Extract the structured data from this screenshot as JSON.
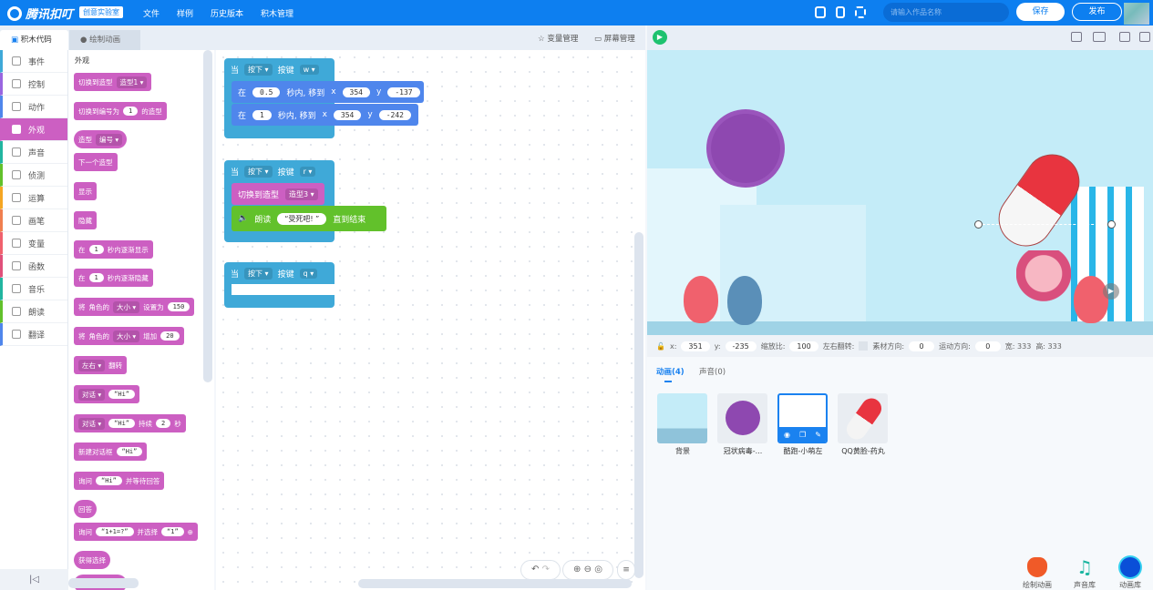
{
  "header": {
    "logo": "腾讯扣叮",
    "lab_badge": "创意实验室",
    "menu": [
      "文件",
      "样例",
      "历史版本",
      "积木管理"
    ],
    "name_placeholder": "请输入作品名称",
    "save": "保存",
    "publish": "发布"
  },
  "editor_tabs": [
    "积木代码",
    "绘制动画"
  ],
  "workspace_tools": {
    "variables": "变量管理",
    "screens": "屏幕管理"
  },
  "categories": [
    {
      "label": "事件",
      "color": "#3fa9d8"
    },
    {
      "label": "控制",
      "color": "#9966e0"
    },
    {
      "label": "动作",
      "color": "#4f86ec"
    },
    {
      "label": "外观",
      "color": "#cc5fc2",
      "active": true
    },
    {
      "label": "声音",
      "color": "#22b5a0"
    },
    {
      "label": "侦测",
      "color": "#62c12b"
    },
    {
      "label": "运算",
      "color": "#f5a623"
    },
    {
      "label": "画笔",
      "color": "#f07f4f"
    },
    {
      "label": "变量",
      "color": "#f0616d"
    },
    {
      "label": "函数",
      "color": "#e0507a"
    },
    {
      "label": "音乐",
      "color": "#22b5a0"
    },
    {
      "label": "朗读",
      "color": "#62c12b"
    },
    {
      "label": "翻译",
      "color": "#4f86ec"
    }
  ],
  "palette": {
    "title": "外观",
    "blocks": {
      "switch_costume": {
        "text": "切换到造型",
        "dd": "造型1"
      },
      "switch_costume_num": {
        "a": "切换到编号为",
        "v": "1",
        "b": "的造型"
      },
      "costume_reporter": {
        "text": "造型",
        "dd": "编号"
      },
      "next_costume": "下一个造型",
      "show": "显示",
      "hide": "隐藏",
      "fade_in": {
        "a": "在",
        "v": "1",
        "b": "秒内逐渐显示"
      },
      "fade_out": {
        "a": "在",
        "v": "1",
        "b": "秒内逐渐隐藏"
      },
      "set_size": {
        "a": "将",
        "b": "角色的",
        "dd": "大小",
        "c": "设置为",
        "v": "150"
      },
      "change_size": {
        "a": "将",
        "b": "角色的",
        "dd": "大小",
        "c": "增加",
        "v": "20"
      },
      "flip": {
        "dd": "左右",
        "b": "翻转"
      },
      "say": {
        "dd": "对话",
        "v": "“Hi”"
      },
      "say_for": {
        "dd": "对话",
        "v": "“Hi”",
        "b": "持续",
        "n": "2",
        "c": "秒"
      },
      "new_dialog": {
        "a": "新建对话框",
        "v": "“Hi”"
      },
      "ask": {
        "a": "询问",
        "v": "“Hi”",
        "b": "并等待回答"
      },
      "answer": "回答",
      "ask_choice": {
        "a": "询问",
        "v": "“1+1=?”",
        "b": "并选择",
        "c": "“1”"
      },
      "get_choice": "获得选择"
    }
  },
  "scripts": [
    {
      "when": "当",
      "event": "按下",
      "key_label": "按键",
      "key": "w",
      "body": [
        {
          "a": "在",
          "t": "0.5",
          "b": "秒内, 移到",
          "x_label": "x",
          "x": "354",
          "y_label": "y",
          "y": "-137"
        },
        {
          "a": "在",
          "t": "1",
          "b": "秒内, 移到",
          "x_label": "x",
          "x": "354",
          "y_label": "y",
          "y": "-242"
        }
      ]
    },
    {
      "when": "当",
      "event": "按下",
      "key_label": "按键",
      "key": "r",
      "switch": {
        "text": "切换到造型",
        "dd": "造型3"
      },
      "speak": {
        "a": "朗读",
        "v": "“受死吧! ”",
        "b": "直到结束"
      }
    },
    {
      "when": "当",
      "event": "按下",
      "key_label": "按键",
      "key": "q"
    }
  ],
  "props": {
    "x_label": "x:",
    "x": "351",
    "y_label": "y:",
    "y": "-235",
    "scale_label": "缩放比:",
    "scale": "100",
    "flip_label": "左右翻转:",
    "costume_dir_label": "素材方向:",
    "costume_dir": "0",
    "move_dir_label": "运动方向:",
    "move_dir": "0",
    "width": "宽: 333",
    "height": "高: 333"
  },
  "asset_tabs": [
    "动画(4)",
    "声音(0)"
  ],
  "sprites": [
    "背景",
    "冠状病毒-...",
    "酷跑-小萌左",
    "QQ黄脸-药丸"
  ],
  "libraries": [
    "绘制动画",
    "声音库",
    "动画库"
  ]
}
